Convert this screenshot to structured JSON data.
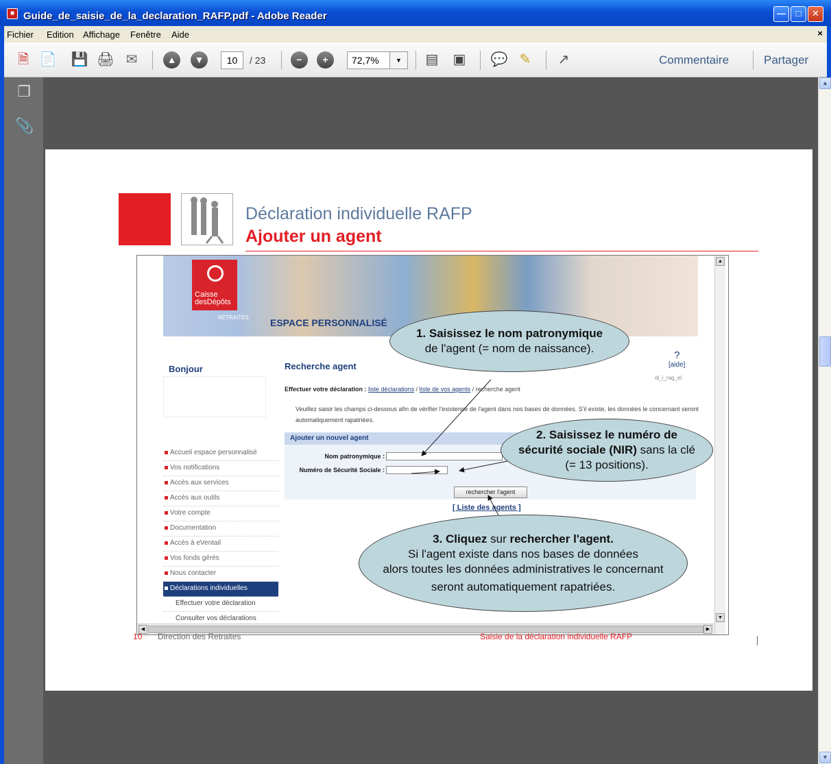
{
  "window": {
    "title": "Guide_de_saisie_de_la_declaration_RAFP.pdf - Adobe Reader"
  },
  "menu": {
    "items": [
      "Fichier",
      "Edition",
      "Affichage",
      "Fenêtre",
      "Aide"
    ],
    "close": "×"
  },
  "toolbar": {
    "current_page": "10",
    "total_pages": "/ 23",
    "zoom": "72,7%",
    "comment": "Commentaire",
    "share": "Partager"
  },
  "slide": {
    "title": "Déclaration individuelle RAFP",
    "subtitle": "Ajouter un agent",
    "footer_page": "10",
    "footer_left": "Direction des Retraites",
    "footer_right": "Saisie de la déclaration individuelle RAFP"
  },
  "site": {
    "logo_line1": "Caisse",
    "logo_line2": "desDépôts",
    "retraites": "RETRAITES",
    "espace": "ESPACE PERSONNALISÉ",
    "bonjour": "Bonjour",
    "nav": [
      "Accueil espace personnalisé",
      "Vos notifications",
      "Accès aux services",
      "Accès aux outils",
      "Votre compte",
      "Documentation",
      "Accès à eVentail",
      "Vos fonds gérés",
      "Nous contacter",
      "Déclarations individuelles"
    ],
    "subnav": [
      "Effectuer votre déclaration",
      "Consulter vos déclarations"
    ],
    "recherche_title": "Recherche agent",
    "aide": "[aide]",
    "aide_icon": "?",
    "dici": "di_i_rag_el",
    "crumb_label": "Effectuer votre déclaration :",
    "crumb_l1": "liste déclarations",
    "crumb_sep": "/",
    "crumb_l2": "liste de vos agents",
    "crumb_end": "/ recherche agent",
    "instructions": "Veuillez saisir les champs ci-dessous afin de vérifier l'existence de l'agent dans nos bases de données. S'il existe, les données le concernant seront automatiquement rapatriées.",
    "form_head": "Ajouter un nouvel agent",
    "label_nom": "Nom patronymique :",
    "label_nss": "Numéro de Sécurité Sociale :",
    "button": "rechercher l'agent",
    "liste_link": "[ Liste des agents ]"
  },
  "callouts": {
    "c1_bold": "1. Saisissez le nom patronymique",
    "c1_text": "de l'agent (= nom de naissance).",
    "c2_bold": "2. Saisissez le numéro de",
    "c2_bold2": "sécurité sociale (NIR)",
    "c2_rest": " sans la clé",
    "c2_text": "(= 13 positions).",
    "c3_b1": "3. Cliquez",
    "c3_t1": " sur ",
    "c3_b2": "rechercher l'agent.",
    "c3_l2": "Si l'agent existe dans nos bases de données",
    "c3_l3": "alors toutes les données administratives le concernant",
    "c3_l4": "seront automatiquement rapatriées."
  }
}
